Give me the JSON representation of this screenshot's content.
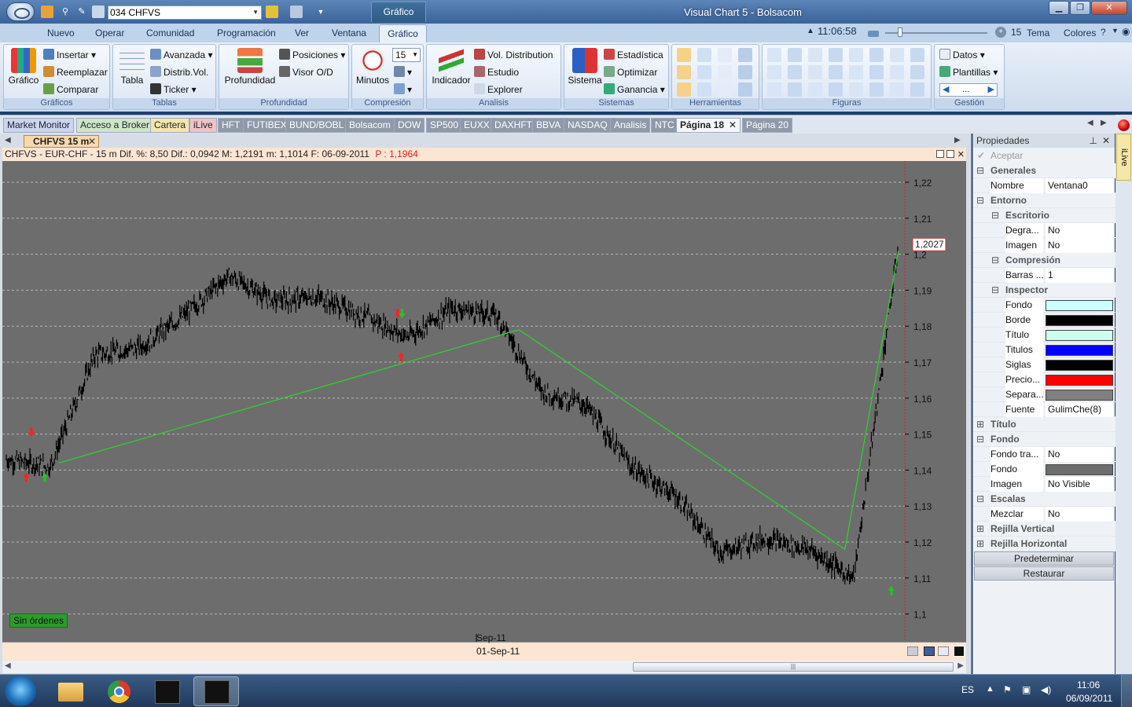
{
  "window": {
    "app_title": "Visual Chart 5 - Bolsacom",
    "context_tab": "Gráfico",
    "symbol": "034 CHFVS",
    "clock": "11:06:58",
    "zoom": "15",
    "theme_label": "Tema",
    "colors_label": "Colores"
  },
  "ribbon_tabs": [
    "Nuevo",
    "Operar",
    "Comunidad",
    "Programación",
    "Ver",
    "Ventana",
    "Gráfico"
  ],
  "ribbon": {
    "graficos": {
      "label": "Gráficos",
      "big": "Gráfico",
      "insert": "Insertar",
      "replace": "Reemplazar",
      "compare": "Comparar"
    },
    "tablas": {
      "label": "Tablas",
      "big": "Tabla",
      "advanced": "Avanzada",
      "distrib": "Distrib.Vol.",
      "ticker": "Ticker"
    },
    "profundidad": {
      "label": "Profundidad",
      "big": "Profundidad",
      "positions": "Posiciones",
      "visor": "Visor O/D"
    },
    "compresion": {
      "label": "Compresión",
      "big": "Minutos",
      "value": "15"
    },
    "analisis": {
      "label": "Analisis",
      "big": "Indicador",
      "vol": "Vol. Distribution",
      "study": "Estudio",
      "explorer": "Explorer"
    },
    "sistemas": {
      "label": "Sistemas",
      "big": "Sistema",
      "stats": "Estadística",
      "optimize": "Optimizar",
      "gain": "Ganancia"
    },
    "herramientas": {
      "label": "Herramientas"
    },
    "figuras": {
      "label": "Figuras"
    },
    "gestion": {
      "label": "Gestión",
      "data": "Datos",
      "templates": "Plantillas",
      "dots": "..."
    }
  },
  "page_tabs": [
    "Market Monitor",
    "Acceso a Broker",
    "Cartera",
    "iLive",
    "HFT",
    "FUTIBEX",
    "BUND/BOBL",
    "Bolsacom",
    "DOW",
    "SP500",
    "EUXX",
    "DAXHFT",
    "BBVA",
    "NASDAQ",
    "Analisis",
    "NTC",
    "Página 18",
    "Página 20"
  ],
  "chart": {
    "tab": "CHFVS 15 m",
    "info": "CHFVS - EUR-CHF -  15 m  Dif. %: 8,50  Dif.: 0,0942  M: 1,2191  m: 1,1014  F: 06-09-2011",
    "info_price": "P : 1,1964",
    "last_price_label": "1,2027",
    "orders_label": "Sin órdenes",
    "time_label_1": "Sep-11",
    "time_label_2": "01-Sep-11",
    "colors": {
      "plot_bg": "#6d6d6d",
      "candle": "#000000",
      "trend": "#2fcf2f",
      "up_signal": "#1fc81f",
      "down_signal": "#ff2020"
    }
  },
  "chart_data": {
    "type": "line",
    "title": "CHFVS - EUR-CHF - 15 m",
    "ylim": [
      1.095,
      1.225
    ],
    "y_ticks": [
      "1,22",
      "1,21",
      "1,2",
      "1,19",
      "1,18",
      "1,17",
      "1,16",
      "1,15",
      "1,14",
      "1,13",
      "1,12",
      "1,11",
      "1,1"
    ],
    "x_labels": [
      "Sep-11",
      "01-Sep-11"
    ],
    "series": [
      {
        "name": "CHFVS",
        "x": [
          0,
          5,
          10,
          15,
          20,
          25,
          30,
          35,
          40,
          45,
          50,
          55,
          60,
          65,
          70,
          75,
          80,
          85,
          90,
          95,
          100
        ],
        "values": [
          1.143,
          1.141,
          1.172,
          1.174,
          1.183,
          1.194,
          1.187,
          1.188,
          1.183,
          1.177,
          1.185,
          1.183,
          1.162,
          1.158,
          1.141,
          1.133,
          1.117,
          1.121,
          1.118,
          1.11,
          1.203
        ]
      },
      {
        "name": "",
        "x": [
          6,
          57.5,
          94,
          100
        ],
        "values": [
          1.142,
          1.179,
          1.118,
          1.201
        ]
      }
    ]
  },
  "properties": {
    "title": "Propiedades",
    "accept": "Aceptar",
    "rows": [
      {
        "kind": "cat",
        "level": 0,
        "label": "Generales",
        "exp": "⊟"
      },
      {
        "kind": "prop",
        "level": 1,
        "label": "Nombre",
        "value": "Ventana0"
      },
      {
        "kind": "cat",
        "level": 0,
        "label": "Entorno",
        "exp": "⊟"
      },
      {
        "kind": "cat",
        "level": 1,
        "label": "Escritorio",
        "exp": "⊟"
      },
      {
        "kind": "prop",
        "level": 2,
        "label": "Degra...",
        "value": "No"
      },
      {
        "kind": "prop",
        "level": 2,
        "label": "Imagen",
        "value": "No"
      },
      {
        "kind": "cat",
        "level": 1,
        "label": "Compresión",
        "exp": "⊟"
      },
      {
        "kind": "prop",
        "level": 2,
        "label": "Barras ...",
        "value": "1"
      },
      {
        "kind": "cat",
        "level": 1,
        "label": "Inspector",
        "exp": "⊟"
      },
      {
        "kind": "color",
        "level": 2,
        "label": "Fondo",
        "color": "#ccffff"
      },
      {
        "kind": "color",
        "level": 2,
        "label": "Borde",
        "color": "#000000"
      },
      {
        "kind": "color",
        "level": 2,
        "label": "Título",
        "color": "#ccffee"
      },
      {
        "kind": "color",
        "level": 2,
        "label": "Titulos",
        "color": "#0000ff"
      },
      {
        "kind": "color",
        "level": 2,
        "label": "Siglas",
        "color": "#000000"
      },
      {
        "kind": "color",
        "level": 2,
        "label": "Precio...",
        "color": "#ff0000"
      },
      {
        "kind": "color",
        "level": 2,
        "label": "Separa...",
        "color": "#808080"
      },
      {
        "kind": "prop",
        "level": 2,
        "label": "Fuente",
        "value": "GulimChe(8)"
      },
      {
        "kind": "cat",
        "level": 0,
        "label": "Título",
        "exp": "⊞"
      },
      {
        "kind": "cat",
        "level": 0,
        "label": "Fondo",
        "exp": "⊟"
      },
      {
        "kind": "prop",
        "level": 1,
        "label": "Fondo tra...",
        "value": "No"
      },
      {
        "kind": "color",
        "level": 1,
        "label": "Fondo",
        "color": "#6d6d6d"
      },
      {
        "kind": "prop",
        "level": 1,
        "label": "Imagen",
        "value": "No Visible"
      },
      {
        "kind": "cat",
        "level": 0,
        "label": "Escalas",
        "exp": "⊟"
      },
      {
        "kind": "prop",
        "level": 1,
        "label": "Mezclar",
        "value": "No"
      },
      {
        "kind": "cat",
        "level": 0,
        "label": "Rejilla Vertical",
        "exp": "⊞"
      },
      {
        "kind": "cat",
        "level": 0,
        "label": "Rejilla Horizontal",
        "exp": "⊞"
      }
    ],
    "btn_default": "Predeterminar",
    "btn_restore": "Restaurar"
  },
  "side_tab": "iLive",
  "taskbar": {
    "lang": "ES",
    "time": "11:06",
    "date": "06/09/2011"
  }
}
